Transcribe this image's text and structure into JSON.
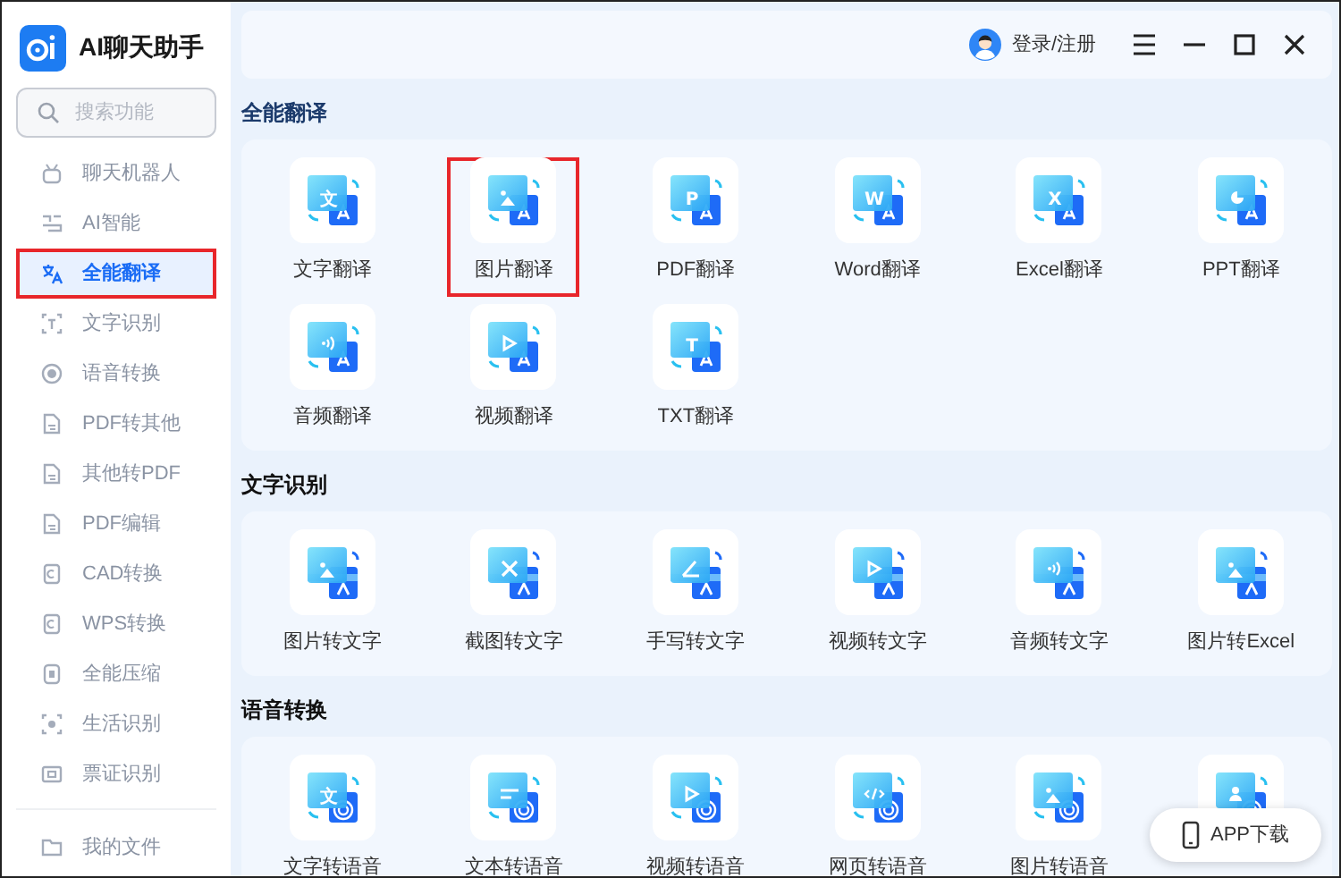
{
  "app": {
    "title": "AI聊天助手"
  },
  "search": {
    "placeholder": "搜索功能"
  },
  "sidebar": {
    "items": [
      {
        "label": "聊天机器人",
        "selected": false,
        "highlighted": false
      },
      {
        "label": "AI智能",
        "selected": false,
        "highlighted": false
      },
      {
        "label": "全能翻译",
        "selected": true,
        "highlighted": true
      },
      {
        "label": "文字识别",
        "selected": false,
        "highlighted": false
      },
      {
        "label": "语音转换",
        "selected": false,
        "highlighted": false
      },
      {
        "label": "PDF转其他",
        "selected": false,
        "highlighted": false
      },
      {
        "label": "其他转PDF",
        "selected": false,
        "highlighted": false
      },
      {
        "label": "PDF编辑",
        "selected": false,
        "highlighted": false
      },
      {
        "label": "CAD转换",
        "selected": false,
        "highlighted": false
      },
      {
        "label": "WPS转换",
        "selected": false,
        "highlighted": false
      },
      {
        "label": "全能压缩",
        "selected": false,
        "highlighted": false
      },
      {
        "label": "生活识别",
        "selected": false,
        "highlighted": false
      },
      {
        "label": "票证识别",
        "selected": false,
        "highlighted": false
      }
    ],
    "footer": {
      "label": "我的文件"
    }
  },
  "header": {
    "login": "登录/注册"
  },
  "sections": [
    {
      "title": "全能翻译",
      "items": [
        {
          "label": "文字翻译",
          "glyph": "文",
          "highlighted": false
        },
        {
          "label": "图片翻译",
          "highlighted": true
        },
        {
          "label": "PDF翻译",
          "glyph": "P",
          "highlighted": false
        },
        {
          "label": "Word翻译",
          "glyph": "W",
          "highlighted": false
        },
        {
          "label": "Excel翻译",
          "glyph": "X",
          "highlighted": false
        },
        {
          "label": "PPT翻译",
          "highlighted": false
        },
        {
          "label": "音频翻译",
          "highlighted": false
        },
        {
          "label": "视频翻译",
          "highlighted": false
        },
        {
          "label": "TXT翻译",
          "glyph": "T",
          "highlighted": false
        }
      ]
    },
    {
      "title": "文字识别",
      "items": [
        {
          "label": "图片转文字",
          "highlighted": false
        },
        {
          "label": "截图转文字",
          "highlighted": false
        },
        {
          "label": "手写转文字",
          "highlighted": false
        },
        {
          "label": "视频转文字",
          "highlighted": false
        },
        {
          "label": "音频转文字",
          "highlighted": false
        },
        {
          "label": "图片转Excel",
          "highlighted": false
        }
      ]
    },
    {
      "title": "语音转换",
      "items": [
        {
          "label": "文字转语音",
          "glyph": "文",
          "highlighted": false
        },
        {
          "label": "文本转语音",
          "highlighted": false
        },
        {
          "label": "视频转语音",
          "highlighted": false
        },
        {
          "label": "网页转语音",
          "highlighted": false
        },
        {
          "label": "图片转语音",
          "highlighted": false
        },
        {
          "highlighted": false
        }
      ]
    }
  ],
  "app_download": {
    "label": "APP下载"
  }
}
